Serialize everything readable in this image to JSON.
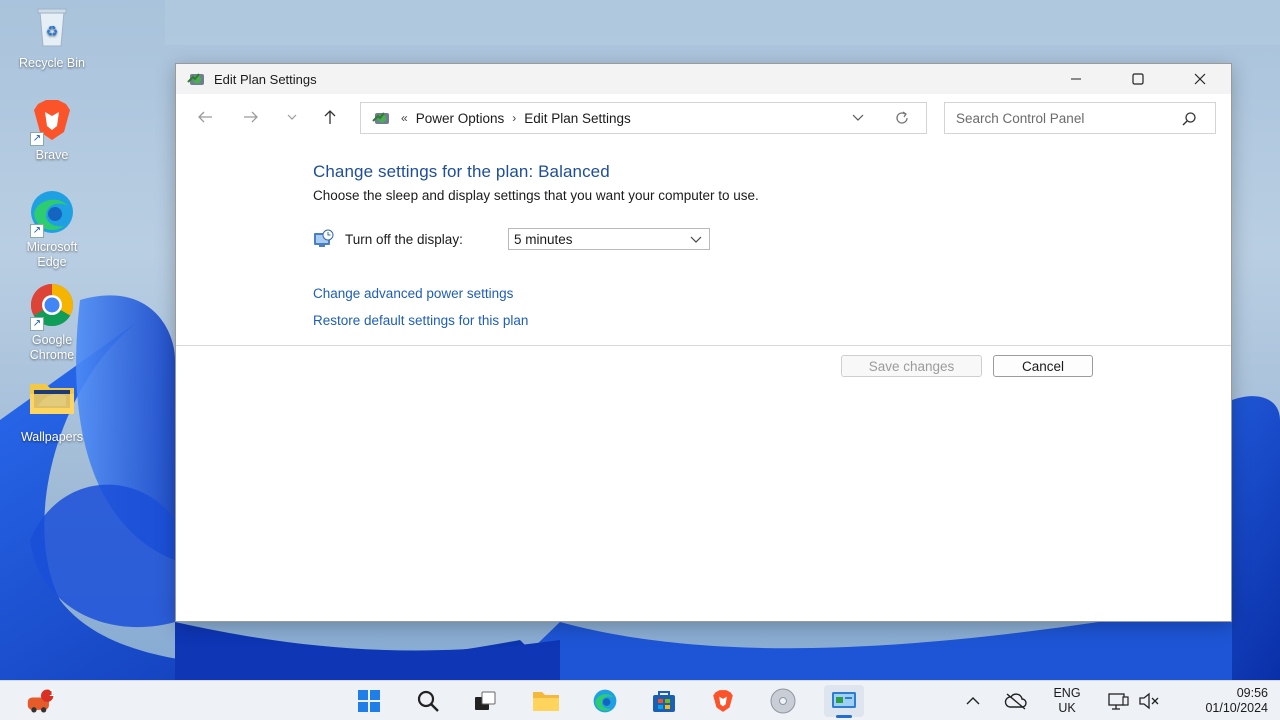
{
  "desktop": {
    "icons": [
      {
        "label": "Recycle Bin"
      },
      {
        "label": "Brave"
      },
      {
        "label": "Microsoft Edge"
      },
      {
        "label": "Google Chrome"
      },
      {
        "label": "Wallpapers"
      }
    ]
  },
  "window": {
    "title": "Edit Plan Settings",
    "address": {
      "overflow": "«",
      "crumbs": [
        "Power Options",
        "Edit Plan Settings"
      ],
      "separator": "›"
    },
    "search": {
      "placeholder": "Search Control Panel"
    },
    "heading": "Change settings for the plan: Balanced",
    "subheading": "Choose the sleep and display settings that you want your computer to use.",
    "display_setting": {
      "label": "Turn off the display:",
      "value": "5 minutes"
    },
    "links": {
      "advanced": "Change advanced power settings",
      "restore": "Restore default settings for this plan"
    },
    "buttons": {
      "save": "Save changes",
      "cancel": "Cancel"
    }
  },
  "taskbar": {
    "notification_badge": "1",
    "language": {
      "line1": "ENG",
      "line2": "UK"
    },
    "clock": {
      "time": "09:56",
      "date": "01/10/2024"
    }
  },
  "colors": {
    "accent": "#1e4e9a",
    "link": "#1e5eb8",
    "taskbar_bg": "#eef1f6"
  }
}
